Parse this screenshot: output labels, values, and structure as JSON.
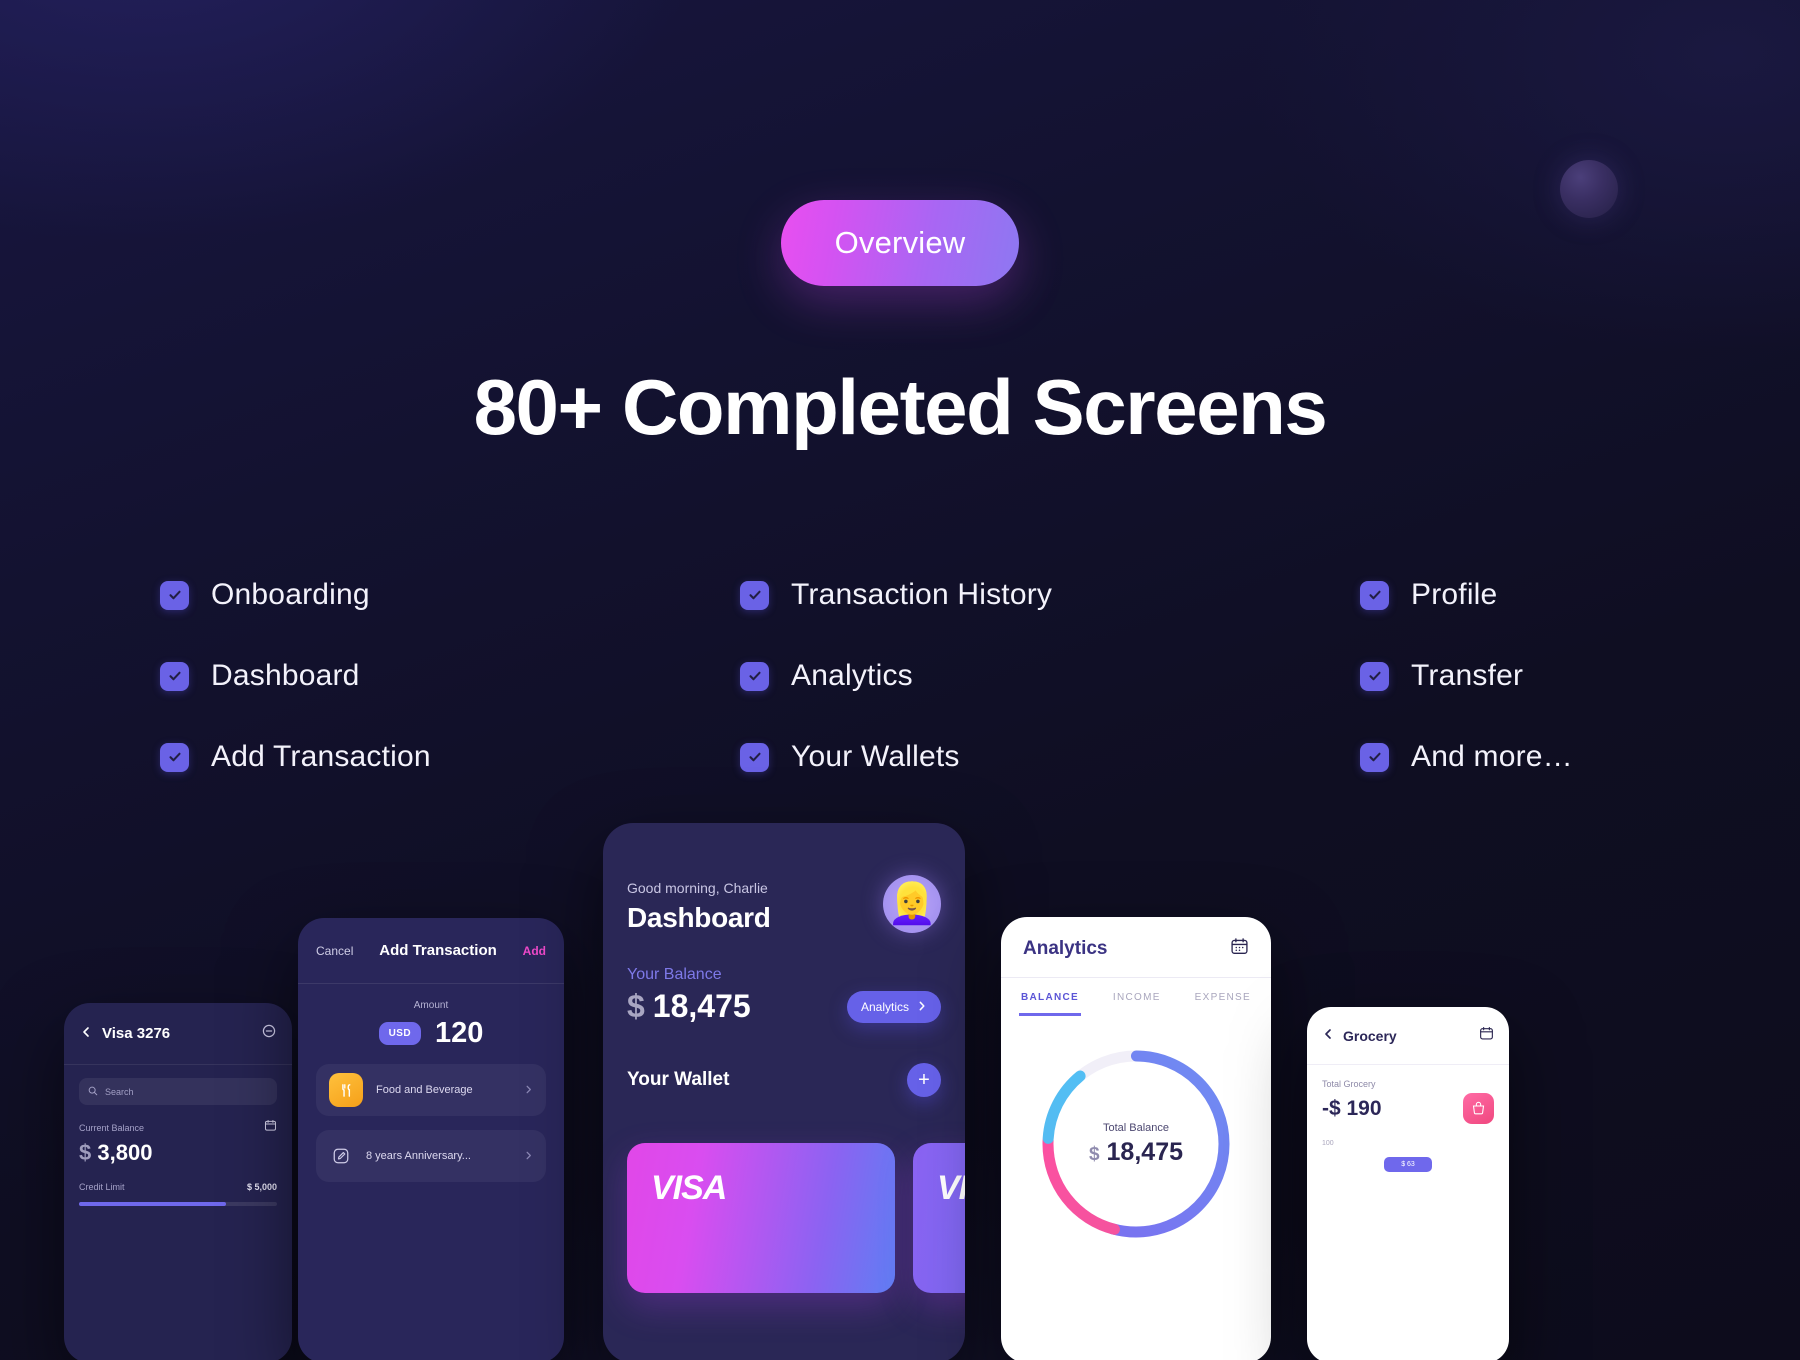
{
  "hero": {
    "badge": "Overview",
    "headline": "80+ Completed Screens"
  },
  "checklist": {
    "items": [
      {
        "label": "Onboarding",
        "checked": true
      },
      {
        "label": "Transaction History",
        "checked": true
      },
      {
        "label": "Profile",
        "checked": true
      },
      {
        "label": "Dashboard",
        "checked": true
      },
      {
        "label": "Analytics",
        "checked": true
      },
      {
        "label": "Transfer",
        "checked": true
      },
      {
        "label": "Add Transaction",
        "checked": true
      },
      {
        "label": "Your Wallets",
        "checked": true
      },
      {
        "label": "And more…",
        "checked": true
      }
    ]
  },
  "phones": {
    "visa": {
      "nav_title": "Visa 3276",
      "back_icon": "chevron-left-icon",
      "action_icon": "minus-circle-icon",
      "search_placeholder": "Search",
      "search_icon": "search-icon",
      "balance_label": "Current Balance",
      "balance_currency": "$",
      "balance_value": "3,800",
      "calendar_icon": "calendar-icon",
      "limit_label": "Credit Limit",
      "limit_value": "$ 5,000"
    },
    "add_transaction": {
      "cancel_label": "Cancel",
      "title": "Add Transaction",
      "add_label": "Add",
      "amount_label": "Amount",
      "currency_badge": "USD",
      "amount_value": "120",
      "rows": [
        {
          "icon": "cutlery-icon",
          "label": "Food and Beverage",
          "chevron": "chevron-right-icon"
        },
        {
          "icon": "pencil-square-icon",
          "label": "8 years Anniversary...",
          "chevron": "chevron-right-icon"
        }
      ]
    },
    "dashboard": {
      "greeting": "Good morning, Charlie",
      "title": "Dashboard",
      "avatar_icon": "user-avatar",
      "balance_label": "Your Balance",
      "balance_currency": "$",
      "balance_value": "18,475",
      "analytics_button": "Analytics",
      "analytics_chevron": "chevron-right-icon",
      "wallet_title": "Your Wallet",
      "add_card_icon": "plus-icon",
      "cards": [
        {
          "brand": "VISA"
        },
        {
          "brand": "VISA"
        }
      ]
    },
    "analytics": {
      "title": "Analytics",
      "calendar_icon": "calendar-icon",
      "tabs": [
        {
          "label": "BALANCE",
          "active": true
        },
        {
          "label": "INCOME",
          "active": false
        },
        {
          "label": "EXPENSE",
          "active": false
        }
      ],
      "donut_label": "Total Balance",
      "donut_currency": "$",
      "donut_value": "18,475"
    },
    "grocery": {
      "back_icon": "chevron-left-icon",
      "title": "Grocery",
      "calendar_icon": "calendar-icon",
      "total_label": "Total Grocery",
      "total_value": "-$ 190",
      "category_icon": "shopping-basket-icon",
      "axis_label": "100",
      "chip_label": "$ 63"
    }
  },
  "colors": {
    "accent_purple": "#6661e8",
    "accent_magenta": "#e94ff0",
    "background": "#13122a",
    "phone_navy": "#2a2756"
  }
}
